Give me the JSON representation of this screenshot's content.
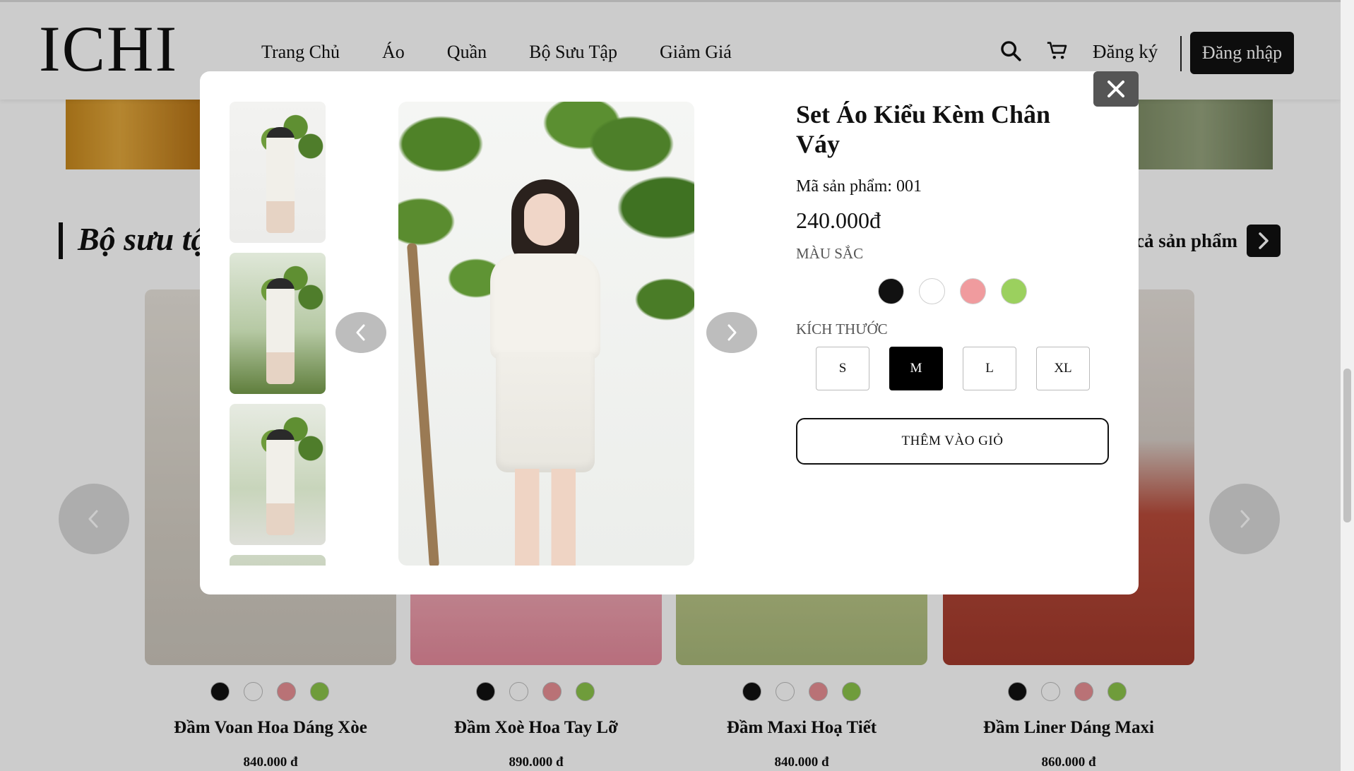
{
  "header": {
    "logo": "ICHI",
    "nav": [
      "Trang Chủ",
      "Áo",
      "Quần",
      "Bộ Sưu Tập",
      "Giảm Giá"
    ],
    "signup_label": "Đăng ký",
    "login_label": "Đăng nhập",
    "icons": [
      "search-icon",
      "cart-icon"
    ]
  },
  "section": {
    "title": "Bộ sưu tậ",
    "view_all": "cả sản phẩm"
  },
  "products": [
    {
      "name": "Đầm Voan Hoa Dáng Xòe",
      "price": "840.000 đ"
    },
    {
      "name": "Đầm Xoè Hoa Tay Lỡ",
      "price": "890.000 đ"
    },
    {
      "name": "Đầm Maxi Hoạ Tiết",
      "price": "840.000 đ"
    },
    {
      "name": "Đầm Liner Dáng Maxi",
      "price": "860.000 đ"
    }
  ],
  "product_swatches": [
    "#111111",
    "#ffffff",
    "#e88f94",
    "#8bc34a"
  ],
  "modal": {
    "title": "Set Áo Kiểu Kèm Chân Váy",
    "sku": "Mã sản phẩm: 001",
    "price": "240.000đ",
    "color_label": "MÀU SẮC",
    "colors": [
      "#111111",
      "#ffffff",
      "#f09b9e",
      "#9bd05e"
    ],
    "size_label": "KÍCH THƯỚC",
    "sizes": [
      "S",
      "M",
      "L",
      "XL"
    ],
    "selected_size": "M",
    "add_to_cart": "THÊM VÀO GIỎ"
  }
}
